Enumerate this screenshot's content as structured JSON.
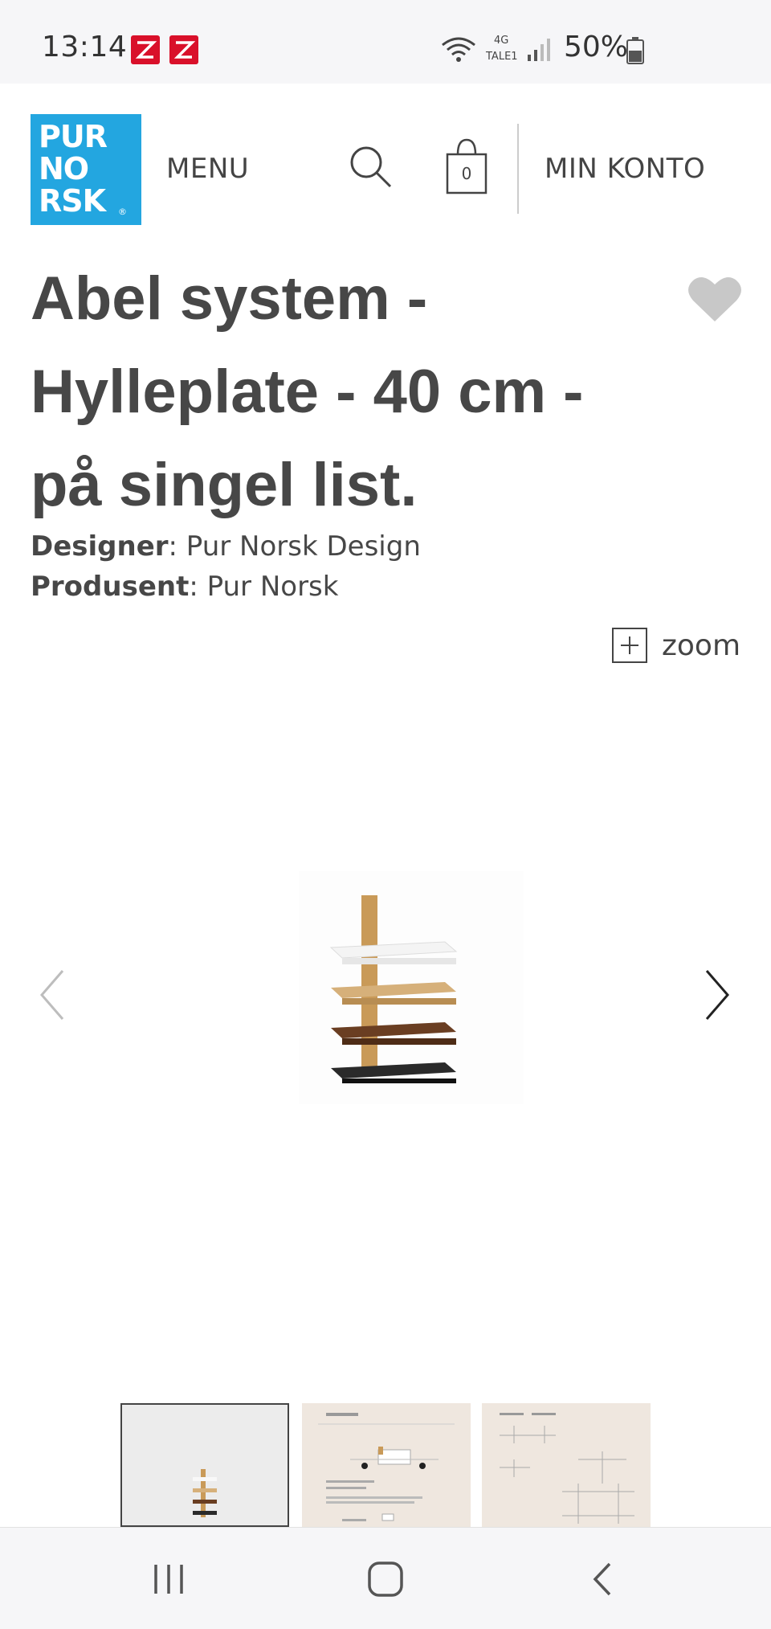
{
  "status_bar": {
    "time": "13:14",
    "network_type": "4G",
    "carrier_label": "TALE1",
    "battery": "50%",
    "badge_color": "#d9102a"
  },
  "header": {
    "logo_text_lines": [
      "PUR",
      "NO",
      "RSK"
    ],
    "logo_mark": "®",
    "logo_color": "#23a6e0",
    "menu_label": "MENU",
    "search_icon": "search-icon",
    "cart_count": "0",
    "account_label": "MIN KONTO"
  },
  "product": {
    "title": "Abel system - Hylleplate - 40 cm - på singel list.",
    "designer_label": "Designer",
    "designer_value": ": Pur Norsk Design",
    "producer_label": "Produsent",
    "producer_value": ": Pur Norsk",
    "favorite_icon": "heart-icon"
  },
  "gallery": {
    "zoom_label": "zoom",
    "thumbnail_count": 3,
    "selected_thumbnail": 1
  },
  "nav_bar": {
    "icons": [
      "recent-apps-icon",
      "home-icon",
      "back-icon"
    ]
  }
}
